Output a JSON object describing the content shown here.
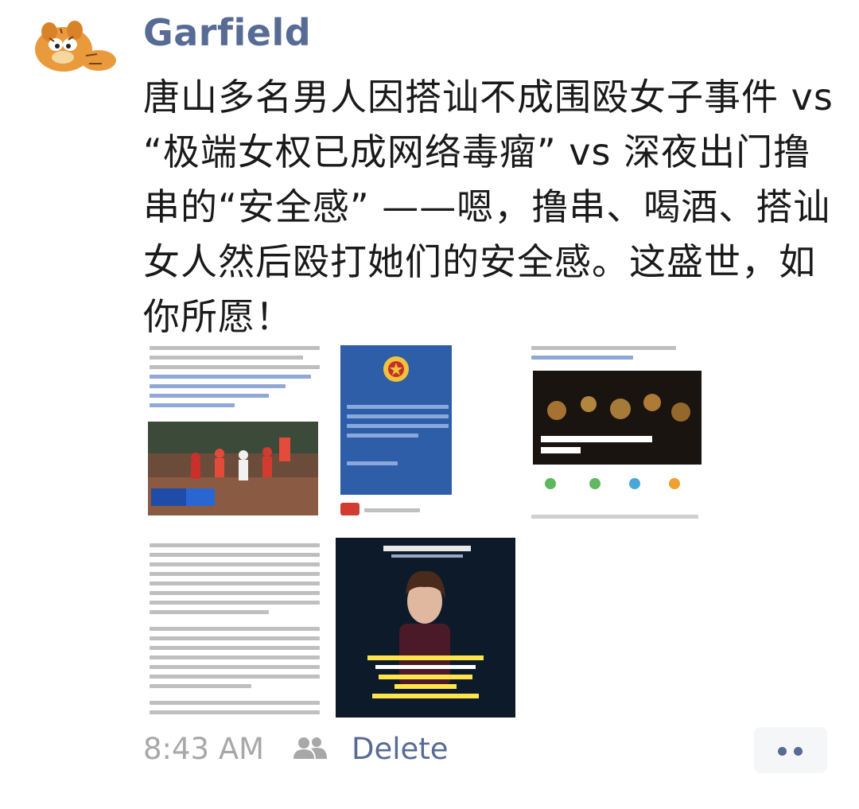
{
  "post": {
    "author": "Garfield",
    "text": "唐山多名男人因搭讪不成围殴女子事件 vs “极端女权已成网络毒瘤” vs 深夜出门撸串的“安全感” ——嗯，撸串、喝酒、搭讪女人然后殴打她们的安全感。这盛世，如你所愿！",
    "images": [
      {
        "name": "news-screenshot-weibo-video",
        "avatar_icon": "news-thumbnail"
      },
      {
        "name": "police-notice-screenshot",
        "avatar_icon": "police-badge"
      },
      {
        "name": "weibo-post-screenshot-candles",
        "avatar_icon": "candles-image"
      },
      {
        "name": "article-text-screenshot",
        "avatar_icon": "text-article"
      },
      {
        "name": "video-still-speaker",
        "avatar_icon": "woman-speaker"
      }
    ],
    "time": "8:43 AM",
    "visibility_icon": "friends-icon",
    "delete_label": "Delete",
    "more_icon": "more-options-icon"
  },
  "colors": {
    "name": "#576b95",
    "meta": "#a8a8a8"
  }
}
